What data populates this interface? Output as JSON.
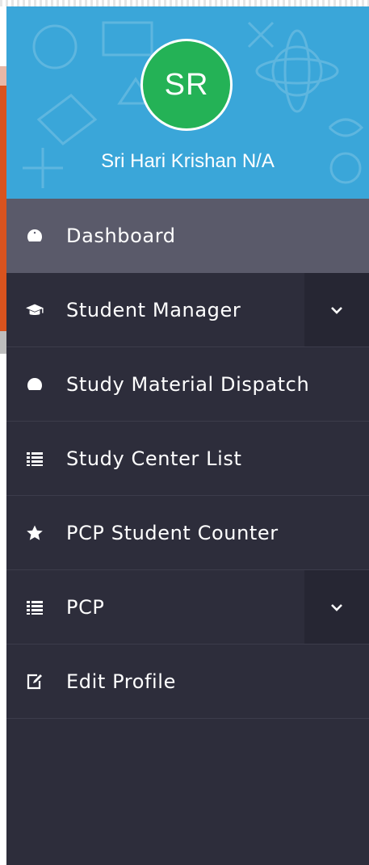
{
  "profile": {
    "initials": "SR",
    "name": "Sri Hari Krishan N/A"
  },
  "menu": [
    {
      "label": "Dashboard",
      "icon": "dashboard-icon",
      "active": true
    },
    {
      "label": "Student Manager",
      "icon": "graduation-cap-icon",
      "expandable": true
    },
    {
      "label": "Study Material Dispatch",
      "icon": "dashboard-icon"
    },
    {
      "label": "Study Center List",
      "icon": "list-icon"
    },
    {
      "label": "PCP Student Counter",
      "icon": "star-icon"
    },
    {
      "label": "PCP",
      "icon": "list-icon",
      "expandable": true
    },
    {
      "label": "Edit Profile",
      "icon": "edit-icon"
    }
  ],
  "colors": {
    "sidebar_bg": "#2d2d3b",
    "profile_bg": "#3aa6d9",
    "avatar_bg": "#24b256",
    "active_item_bg": "#5a5a6a",
    "chevron_bg": "#262633",
    "background_accent": "#d9531e"
  }
}
